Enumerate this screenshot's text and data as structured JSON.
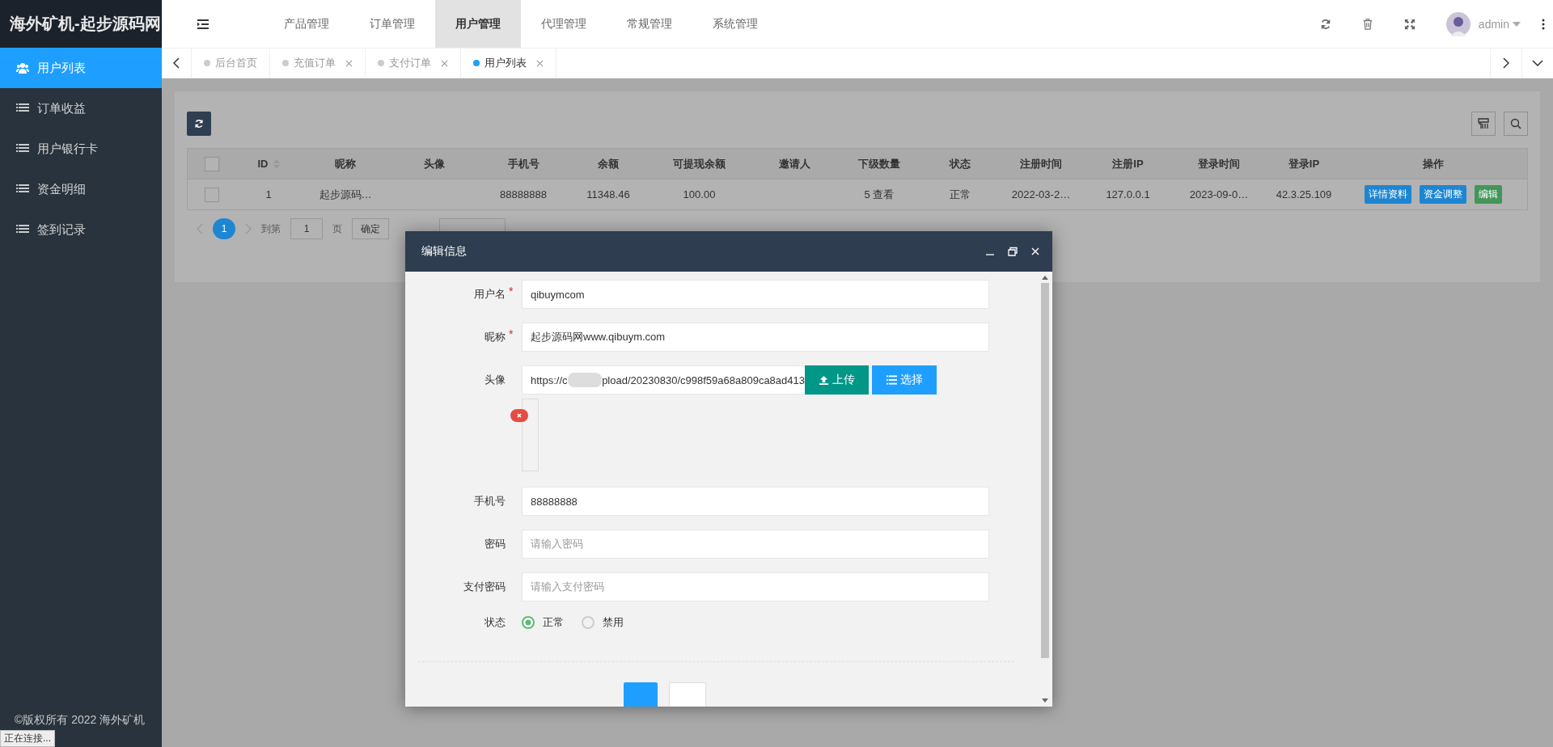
{
  "brand": "海外矿机-起步源码网",
  "top_nav": [
    {
      "label": "产品管理",
      "selected": false
    },
    {
      "label": "订单管理",
      "selected": false
    },
    {
      "label": "用户管理",
      "selected": true
    },
    {
      "label": "代理管理",
      "selected": false
    },
    {
      "label": "常规管理",
      "selected": false
    },
    {
      "label": "系统管理",
      "selected": false
    }
  ],
  "user": {
    "name": "admin"
  },
  "tabs": [
    {
      "label": "后台首页",
      "selected": false,
      "closable": false
    },
    {
      "label": "充值订单",
      "selected": false,
      "closable": true
    },
    {
      "label": "支付订单",
      "selected": false,
      "closable": true
    },
    {
      "label": "用户列表",
      "selected": true,
      "closable": true
    }
  ],
  "sidebar": {
    "items": [
      {
        "label": "用户列表",
        "selected": true,
        "kind": "users"
      },
      {
        "label": "订单收益",
        "selected": false,
        "kind": "list"
      },
      {
        "label": "用户银行卡",
        "selected": false,
        "kind": "list"
      },
      {
        "label": "资金明细",
        "selected": false,
        "kind": "list"
      },
      {
        "label": "签到记录",
        "selected": false,
        "kind": "list"
      }
    ],
    "footer": "©版权所有 2022 海外矿机"
  },
  "table": {
    "all_checked": false,
    "columns": [
      "ID",
      "昵称",
      "头像",
      "手机号",
      "余额",
      "可提现余额",
      "邀请人",
      "下级数量",
      "状态",
      "注册时间",
      "注册IP",
      "登录时间",
      "登录IP",
      "操作"
    ],
    "rows": [
      {
        "checked": false,
        "cells": [
          "1",
          "起步源码…",
          "",
          "88888888",
          "11348.46",
          "100.00",
          "",
          "5 查看",
          "正常",
          "2022-03-2…",
          "127.0.0.1",
          "2023-09-0…",
          "42.3.25.109"
        ],
        "actions": [
          {
            "label": "详情资料",
            "color": "#1e86d1"
          },
          {
            "label": "资金调整",
            "color": "#1e86d1"
          },
          {
            "label": "编辑",
            "color": "#43965a"
          }
        ]
      }
    ]
  },
  "pagination": {
    "current": "1",
    "goto_label": "到第",
    "page_input": "1",
    "page_unit": "页",
    "confirm": "确定"
  },
  "dialog": {
    "title": "编辑信息",
    "fields": [
      {
        "kind": "text",
        "label": "用户名",
        "mark": "*",
        "value": "qibuymcom"
      },
      {
        "kind": "text",
        "label": "昵称",
        "mark": "*",
        "value": "起步源码网www.qibuym.com"
      },
      {
        "kind": "image",
        "label": "头像",
        "url_start": "https://c",
        "url_end": "pload/20230830/c998f59a68a809ca8ad413",
        "upload": "上传",
        "choose": "选择"
      },
      {
        "kind": "text",
        "label": "手机号",
        "value": "88888888"
      },
      {
        "kind": "text",
        "label": "密码",
        "placeholder": "请输入密码"
      },
      {
        "kind": "text",
        "label": "支付密码",
        "placeholder": "请输入支付密码"
      },
      {
        "kind": "radio",
        "label": "状态",
        "options": [
          {
            "label": "正常",
            "selected": true
          },
          {
            "label": "禁用",
            "selected": false
          }
        ]
      }
    ]
  },
  "status_tooltip": "正在连接..."
}
